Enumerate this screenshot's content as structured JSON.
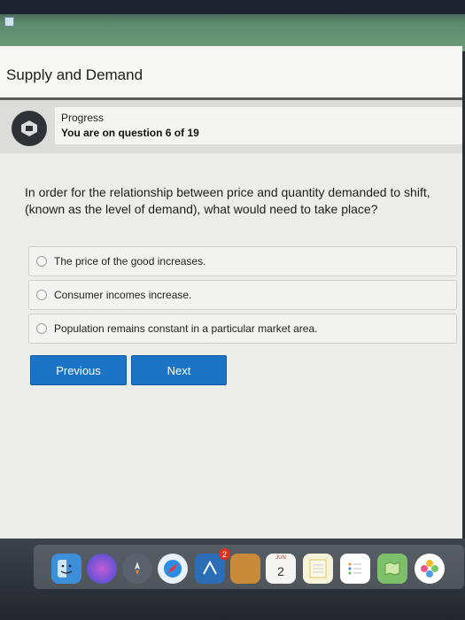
{
  "page": {
    "title": "Supply and Demand"
  },
  "progress": {
    "label": "Progress",
    "status": "You are on question 6 of 19",
    "current": 6,
    "total": 19
  },
  "question": {
    "text": "In order for the relationship between price and quantity demanded to shift, (known as the level of demand), what would need to take place?",
    "options": [
      {
        "label": "The price of the good increases."
      },
      {
        "label": "Consumer incomes increase."
      },
      {
        "label": "Population remains constant in a particular market area."
      }
    ]
  },
  "nav": {
    "previous_label": "Previous",
    "next_label": "Next"
  },
  "dock": {
    "items": [
      {
        "icon": "finder-icon"
      },
      {
        "icon": "siri-icon"
      },
      {
        "icon": "launchpad-icon"
      },
      {
        "icon": "safari-icon"
      },
      {
        "icon": "app-store-icon",
        "badge": "2"
      },
      {
        "icon": "notes-folder-icon"
      },
      {
        "icon": "calendar-icon",
        "month": "JUN",
        "day": "2"
      },
      {
        "icon": "notepad-icon"
      },
      {
        "icon": "reminders-icon"
      },
      {
        "icon": "maps-icon"
      },
      {
        "icon": "photos-icon"
      }
    ]
  },
  "colors": {
    "accent": "#1b74c5",
    "background": "#ecede9"
  }
}
